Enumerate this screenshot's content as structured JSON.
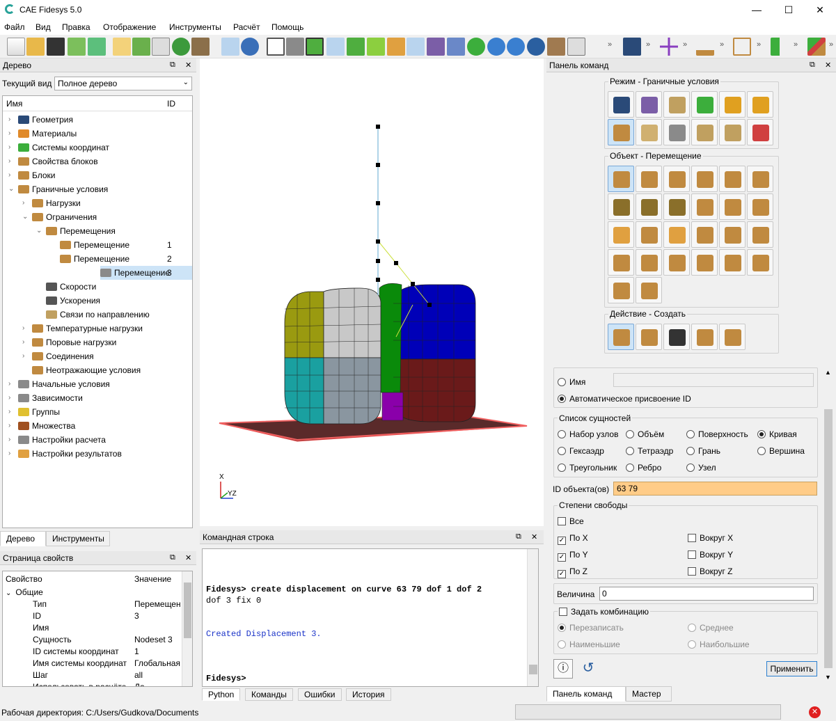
{
  "app": {
    "title": "CAE Fidesys 5.0",
    "min": "—",
    "max": "☐",
    "close": "✕"
  },
  "menu": [
    "Файл",
    "Вид",
    "Правка",
    "Отображение",
    "Инструменты",
    "Расчёт",
    "Помощь"
  ],
  "tree_panel": {
    "title": "Дерево",
    "view_label": "Текущий вид",
    "view_value": "Полное дерево",
    "col_name": "Имя",
    "col_id": "ID",
    "items": [
      {
        "label": "Геометрия",
        "level": 0,
        "exp": ">"
      },
      {
        "label": "Материалы",
        "level": 0,
        "exp": ">"
      },
      {
        "label": "Системы координат",
        "level": 0,
        "exp": ">"
      },
      {
        "label": "Свойства блоков",
        "level": 0,
        "exp": ">"
      },
      {
        "label": "Блоки",
        "level": 0,
        "exp": ">"
      },
      {
        "label": "Граничные условия",
        "level": 0,
        "exp": "v"
      },
      {
        "label": "Нагрузки",
        "level": 1,
        "exp": ">"
      },
      {
        "label": "Ограничения",
        "level": 1,
        "exp": "v"
      },
      {
        "label": "Перемещения",
        "level": 2,
        "exp": "v"
      },
      {
        "label": "Перемещение",
        "level": 3,
        "exp": "",
        "id": "1"
      },
      {
        "label": "Перемещение",
        "level": 3,
        "exp": "",
        "id": "2"
      },
      {
        "label": "Перемещение",
        "level": 3,
        "exp": "",
        "id": "3",
        "selected": true
      },
      {
        "label": "Скорости",
        "level": 2,
        "exp": ""
      },
      {
        "label": "Ускорения",
        "level": 2,
        "exp": ""
      },
      {
        "label": "Связи по направлению",
        "level": 2,
        "exp": ""
      },
      {
        "label": "Температурные нагрузки",
        "level": 1,
        "exp": ">"
      },
      {
        "label": "Поровые нагрузки",
        "level": 1,
        "exp": ">"
      },
      {
        "label": "Соединения",
        "level": 1,
        "exp": ">"
      },
      {
        "label": "Неотражающие условия",
        "level": 1,
        "exp": ""
      },
      {
        "label": "Начальные условия",
        "level": 0,
        "exp": ">"
      },
      {
        "label": "Зависимости",
        "level": 0,
        "exp": ">"
      },
      {
        "label": "Группы",
        "level": 0,
        "exp": ">"
      },
      {
        "label": "Множества",
        "level": 0,
        "exp": ">"
      },
      {
        "label": "Настройки расчета",
        "level": 0,
        "exp": ">"
      },
      {
        "label": "Настройки результатов",
        "level": 0,
        "exp": ">"
      }
    ],
    "tabs": [
      "Дерево",
      "Инструменты"
    ]
  },
  "props_panel": {
    "title": "Страница свойств",
    "col_prop": "Свойство",
    "col_val": "Значение",
    "group": "Общие",
    "rows": [
      {
        "k": "Тип",
        "v": "Перемещен"
      },
      {
        "k": "ID",
        "v": "3"
      },
      {
        "k": "Имя",
        "v": ""
      },
      {
        "k": "Сущность",
        "v": "Nodeset 3"
      },
      {
        "k": "ID системы координат",
        "v": "1"
      },
      {
        "k": "Имя системы координат",
        "v": "Глобальная"
      },
      {
        "k": "Шаг",
        "v": "all"
      },
      {
        "k": "Использовать в расчёте",
        "v": "Да"
      }
    ]
  },
  "viewport": {
    "axis_x": "X",
    "axis_yz": "YZ"
  },
  "cmd_panel": {
    "title": "Командная строка",
    "line1": "Fidesys> create displacement  on curve 63 79 dof 1 dof 2",
    "line2": "dof 3 fix 0",
    "line3": "Created Displacement 3.",
    "prompt": "Fidesys>",
    "tabs": [
      "Python",
      "Команды",
      "Ошибки",
      "История"
    ]
  },
  "commands": {
    "title": "Панель команд",
    "mode_label": "Режим - Граничные условия",
    "object_label": "Объект - Перемещение",
    "action_label": "Действие - Создать",
    "name_radio": "Имя",
    "auto_radio": "Автоматическое присвоение ID",
    "entity_group": "Список сущностей",
    "entities": [
      "Набор узлов",
      "Объём",
      "Поверхность",
      "Кривая",
      "Гексаэдр",
      "Тетраэдр",
      "Грань",
      "Вершина",
      "Треугольник",
      "Ребро",
      "Узел"
    ],
    "id_label": "ID объекта(ов)",
    "id_value": "63 79",
    "dof_group": "Степени свободы",
    "dof_all": "Все",
    "dof_x": "По X",
    "dof_y": "По Y",
    "dof_z": "По Z",
    "rot_x": "Вокруг X",
    "rot_y": "Вокруг Y",
    "rot_z": "Вокруг Z",
    "mag_label": "Величина",
    "mag_value": "0",
    "combo_label": "Задать комбинацию",
    "overwrite": "Перезаписать",
    "average": "Среднее",
    "min": "Наименьшие",
    "max": "Наибольшие",
    "apply": "Применить",
    "tabs": [
      "Панель команд",
      "Мастер"
    ]
  },
  "status": {
    "workdir": "Рабочая директория: C:/Users/Gudkova/Documents"
  },
  "colors": {
    "accent": "#ffcc88",
    "selected": "#cde4f7"
  }
}
